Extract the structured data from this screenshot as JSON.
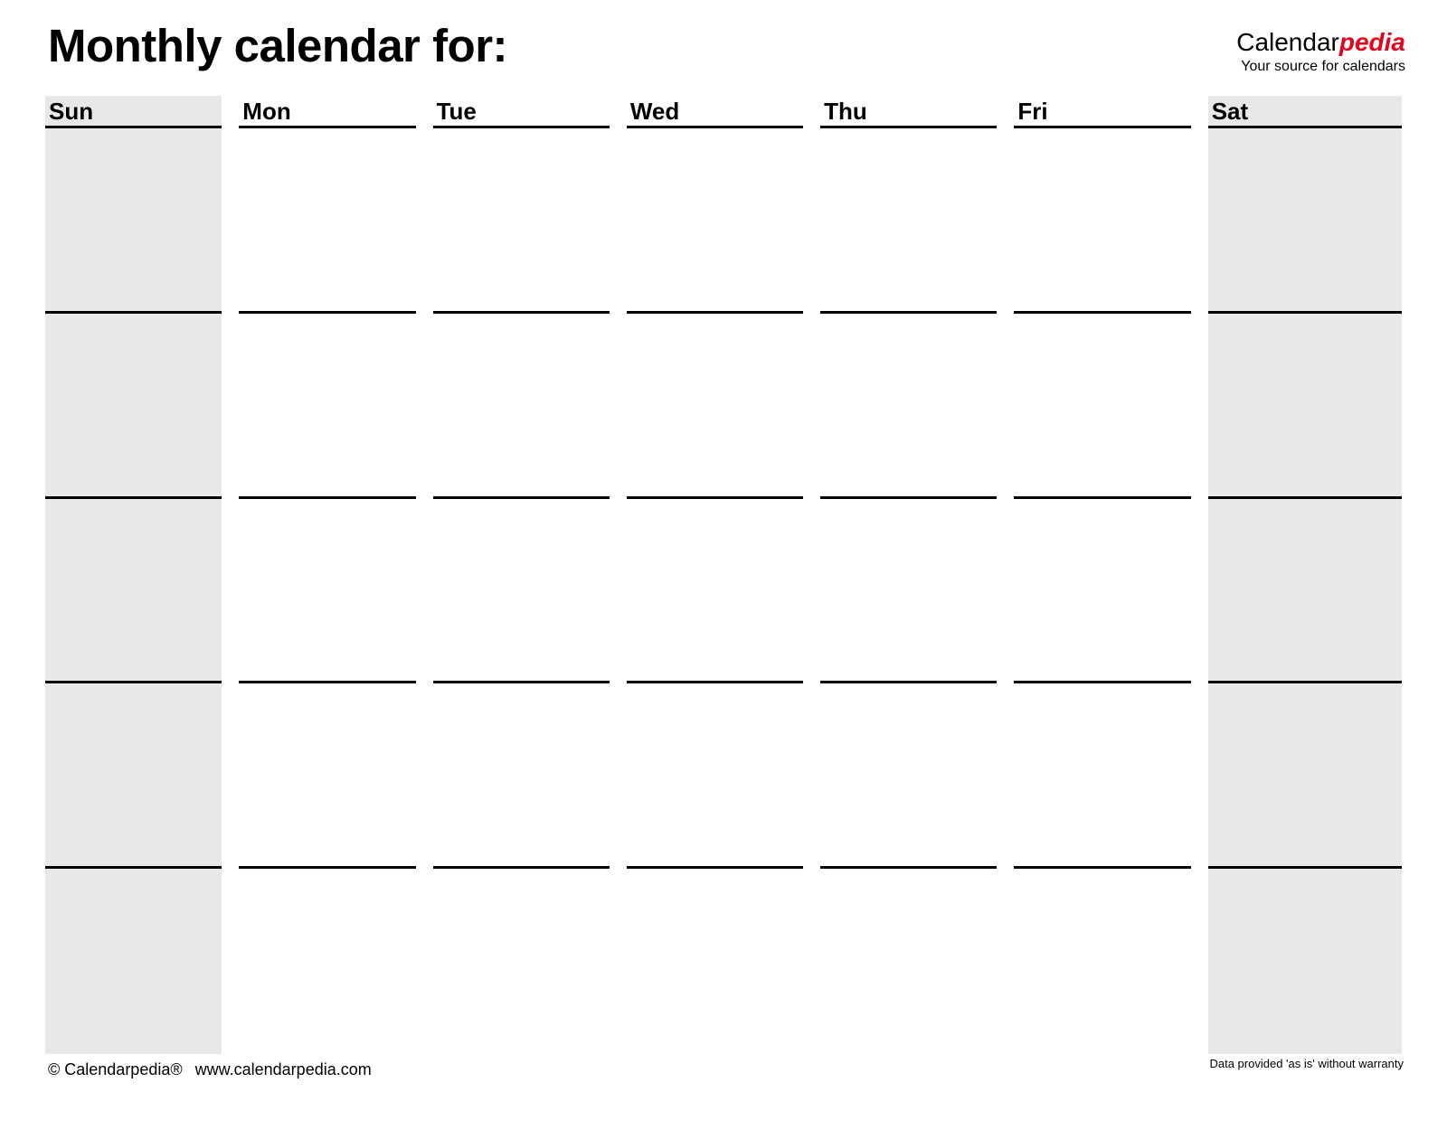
{
  "header": {
    "title": "Monthly calendar for:",
    "brand": {
      "name_part1": "Calendar",
      "name_part2": "pedia",
      "tagline": "Your source for calendars",
      "accent_color": "#e3051b"
    }
  },
  "calendar": {
    "weekend_background": "#e8e8e8",
    "line_color": "#000000",
    "day_headers": [
      {
        "label": "Sun",
        "weekend": true
      },
      {
        "label": "Mon",
        "weekend": false
      },
      {
        "label": "Tue",
        "weekend": false
      },
      {
        "label": "Wed",
        "weekend": false
      },
      {
        "label": "Thu",
        "weekend": false
      },
      {
        "label": "Fri",
        "weekend": false
      },
      {
        "label": "Sat",
        "weekend": true
      }
    ],
    "week_rows": 5,
    "cells": [
      [
        "",
        "",
        "",
        "",
        "",
        "",
        ""
      ],
      [
        "",
        "",
        "",
        "",
        "",
        "",
        ""
      ],
      [
        "",
        "",
        "",
        "",
        "",
        "",
        ""
      ],
      [
        "",
        "",
        "",
        "",
        "",
        "",
        ""
      ],
      [
        "",
        "",
        "",
        "",
        "",
        "",
        ""
      ]
    ]
  },
  "footer": {
    "copyright": "© Calendarpedia®",
    "website": "www.calendarpedia.com",
    "disclaimer": "Data provided 'as is' without warranty"
  }
}
